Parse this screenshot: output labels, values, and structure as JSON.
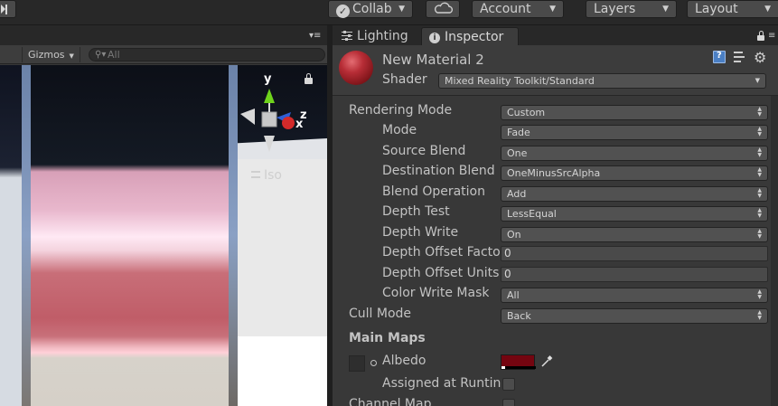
{
  "toolbar": {
    "collab_label": "Collab",
    "account_label": "Account",
    "layers_label": "Layers",
    "layout_label": "Layout"
  },
  "scene": {
    "gizmos_label": "Gizmos",
    "search_placeholder": "All",
    "projection_label": "Iso",
    "gizmo_axes": {
      "x": "x",
      "y": "y",
      "z": "z"
    }
  },
  "inspector_tabs": {
    "lighting_label": "Lighting",
    "inspector_label": "Inspector"
  },
  "material": {
    "name": "New Material 2",
    "shader_label": "Shader",
    "shader_value": "Mixed Reality Toolkit/Standard"
  },
  "properties": {
    "rendering_mode": {
      "label": "Rendering Mode",
      "value": "Custom"
    },
    "mode": {
      "label": "Mode",
      "value": "Fade"
    },
    "source_blend": {
      "label": "Source Blend",
      "value": "One"
    },
    "destination_blend": {
      "label": "Destination Blend",
      "value": "OneMinusSrcAlpha"
    },
    "blend_operation": {
      "label": "Blend Operation",
      "value": "Add"
    },
    "depth_test": {
      "label": "Depth Test",
      "value": "LessEqual"
    },
    "depth_write": {
      "label": "Depth Write",
      "value": "On"
    },
    "depth_offset_factor": {
      "label": "Depth Offset Facto",
      "value": "0"
    },
    "depth_offset_units": {
      "label": "Depth Offset Units",
      "value": "0"
    },
    "color_write_mask": {
      "label": "Color Write Mask",
      "value": "All"
    },
    "cull_mode": {
      "label": "Cull Mode",
      "value": "Back"
    }
  },
  "main_maps": {
    "section_label": "Main Maps",
    "albedo_label": "Albedo",
    "albedo_color": "#740510",
    "assigned_label": "Assigned at Runtin",
    "channel_map_label": "Channel Map"
  },
  "colors": {
    "panel_bg": "#383838",
    "toolbar_bg": "#282828",
    "field_bg": "#515151",
    "material_ball": "#b72d36"
  }
}
